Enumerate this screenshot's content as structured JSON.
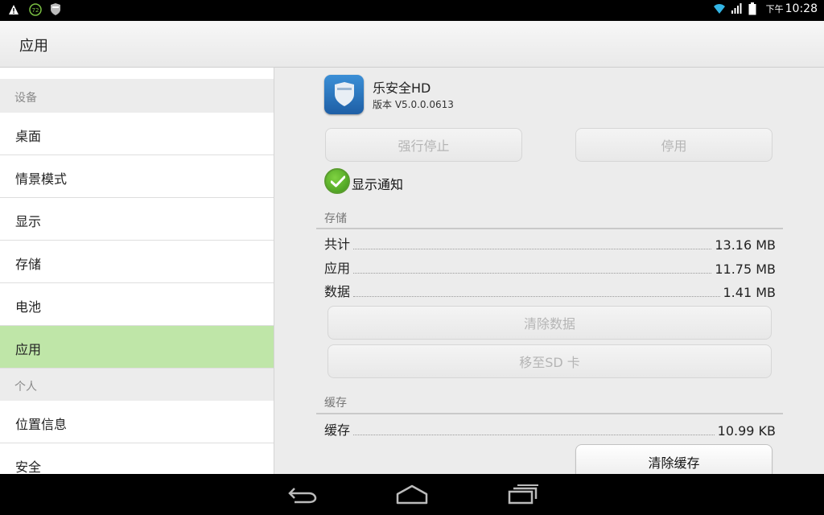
{
  "status_bar": {
    "left_icons": [
      "warning-icon",
      "battery-72-icon",
      "security-shield-icon"
    ],
    "battery_percent_badge": "72",
    "time_prefix": "下午",
    "time": "10:28",
    "right_icons": [
      "wifi-icon",
      "signal-icon",
      "battery-icon"
    ]
  },
  "action_bar": {
    "title": "应用"
  },
  "sidebar": {
    "section_device": "设备",
    "device_items": [
      {
        "label": "桌面"
      },
      {
        "label": "情景模式"
      },
      {
        "label": "显示"
      },
      {
        "label": "存储"
      },
      {
        "label": "电池"
      },
      {
        "label": "应用",
        "active": true
      }
    ],
    "section_personal": "个人",
    "personal_items": [
      {
        "label": "位置信息"
      },
      {
        "label": "安全"
      }
    ]
  },
  "app_info": {
    "name": "乐安全HD",
    "version": "版本 V5.0.0.0613",
    "force_stop_label": "强行停止",
    "disable_label": "停用",
    "show_notifications_label": "显示通知",
    "show_notifications_checked": true
  },
  "storage": {
    "section_label": "存储",
    "rows": [
      {
        "label": "共计",
        "value": "13.16 MB"
      },
      {
        "label": "应用",
        "value": "11.75 MB"
      },
      {
        "label": "数据",
        "value": "1.41 MB"
      }
    ],
    "clear_data_label": "清除数据",
    "move_to_sd_label": "移至SD 卡"
  },
  "cache": {
    "section_label": "缓存",
    "rows": [
      {
        "label": "缓存",
        "value": "10.99 KB"
      }
    ],
    "clear_cache_label": "清除缓存"
  },
  "nav_bar": {
    "buttons": [
      "back-icon",
      "home-icon",
      "recent-apps-icon"
    ]
  }
}
